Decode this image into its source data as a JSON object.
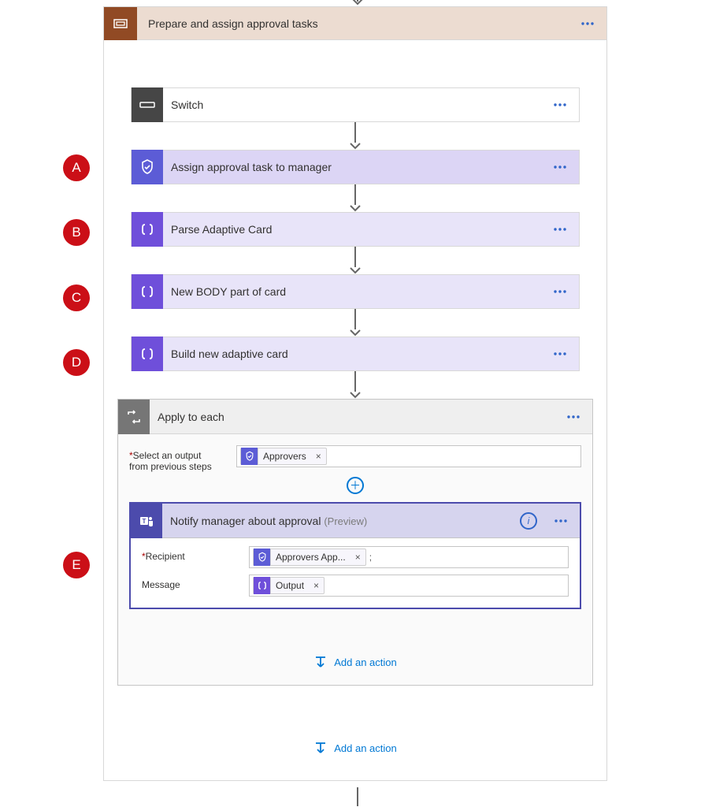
{
  "scope": {
    "title": "Prepare and assign approval tasks"
  },
  "steps": {
    "switch": {
      "label": "Switch"
    },
    "assign": {
      "label": "Assign approval task to manager"
    },
    "parse": {
      "label": "Parse Adaptive Card"
    },
    "newbody": {
      "label": "New BODY part of card"
    },
    "build": {
      "label": "Build new adaptive card"
    }
  },
  "apply": {
    "title": "Apply to each",
    "field_label_line1": "Select an output",
    "field_label_line2": "from previous steps",
    "token_approvers": "Approvers"
  },
  "notify": {
    "title": "Notify manager about approval",
    "preview": "(Preview)",
    "recipient_label": "Recipient",
    "recipient_token": "Approvers App...",
    "semicolon": ";",
    "message_label": "Message",
    "message_token": "Output"
  },
  "add_action": "Add an action",
  "badges": {
    "a": "A",
    "b": "B",
    "c": "C",
    "d": "D",
    "e": "E"
  }
}
